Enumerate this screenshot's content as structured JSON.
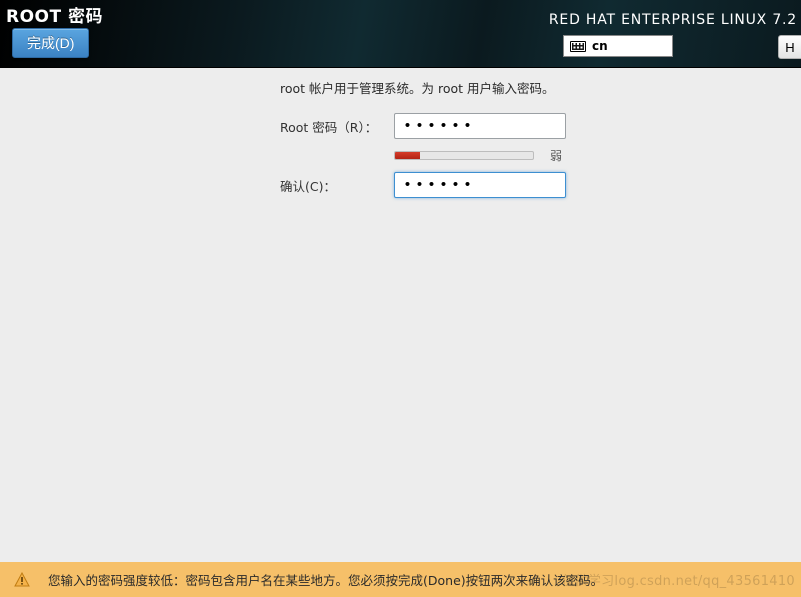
{
  "header": {
    "title": "ROOT 密码",
    "done_label": "完成(D)",
    "distro_label": "RED HAT ENTERPRISE LINUX 7.2",
    "keyboard_layout": "cn",
    "help_label": "H"
  },
  "form": {
    "intro": "root 帐户用于管理系统。为 root 用户输入密码。",
    "password_label": "Root 密码（R）：",
    "confirm_label": "确认(C)：",
    "password_value": "●●●●●●",
    "confirm_value": "●●●●●●",
    "strength": {
      "percent": 18,
      "text": "弱"
    }
  },
  "warning": {
    "message": "您输入的密码强度较低：密码包含用户名在某些地方。您必须按完成(Done)按钮两次来确认该密码。"
  },
  "watermark": "仅供学习log.csdn.net/qq_43561410"
}
